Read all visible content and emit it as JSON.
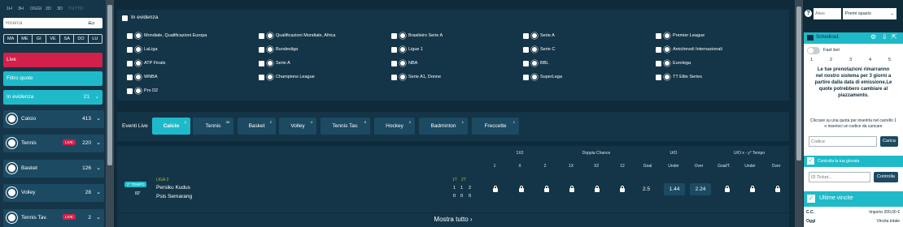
{
  "time_filters": [
    "1H",
    "3H",
    "OGGI",
    "2D",
    "3D",
    "TUTTO"
  ],
  "search": {
    "placeholder": "Ricerca"
  },
  "days": [
    "MA",
    "ME",
    "GI",
    "VE",
    "SA",
    "DO",
    "LU"
  ],
  "left_menu": {
    "live": "Live",
    "filtro": "Filtro quote",
    "evidenza": "In evidenza",
    "evidenza_count": "21"
  },
  "sports": [
    {
      "name": "Calcio",
      "count": "413",
      "live": false
    },
    {
      "name": "Tennis",
      "count": "220",
      "live": true
    },
    {
      "name": "Basket",
      "count": "126",
      "live": false
    },
    {
      "name": "Volley",
      "count": "28",
      "live": false
    },
    {
      "name": "Tennis Tav.",
      "count": "2",
      "live": true
    }
  ],
  "live_badge": "LIVE",
  "featured": {
    "title": "In evidenza",
    "items": [
      "Mondiale, Qualificazioni Europa",
      "Qualificazioni Mondiale, Africa",
      "Brasileiro Serie A",
      "Serie A",
      "Premier League",
      "LaLiga",
      "Bundesliga",
      "Ligue 1",
      "Serie C",
      "Amichevoli Internazionali",
      "ATP Finals",
      "Serie A",
      "NBA",
      "BBL",
      "Eurolega",
      "WNBA",
      "Champions League",
      "Serie A1, Donne",
      "SuperLega",
      "TT Elite Series",
      "Pro D2"
    ]
  },
  "eventi_live": {
    "label": "Eventi Live",
    "tabs": [
      {
        "label": "Calcio",
        "count": "1",
        "active": true
      },
      {
        "label": "Tennis",
        "count": "38"
      },
      {
        "label": "Basket",
        "count": "2"
      },
      {
        "label": "Volley",
        "count": "4"
      },
      {
        "label": "Tennis Tav.",
        "count": "9"
      },
      {
        "label": "Hockey",
        "count": "2"
      },
      {
        "label": "Badminton",
        "count": "1"
      },
      {
        "label": "Freccette",
        "count": "1"
      }
    ]
  },
  "table": {
    "groups": [
      "1X2",
      "Doppia Chance",
      "U/O",
      "U/O x - y° Tempo"
    ],
    "cols": [
      "1",
      "X",
      "2",
      "1X",
      "X2",
      "12",
      "Goal",
      "Under",
      "Over",
      "Goal/T.",
      "Under",
      "Over"
    ],
    "match": {
      "period": "2° TEMPO",
      "minute": "82'",
      "league": "LIGA 2",
      "home": "Persiku Kudus",
      "away": "Psis Semarang",
      "h1t": "1T",
      "h2t": "2T",
      "s1": [
        "1",
        "1",
        "2"
      ],
      "s2": [
        "0",
        "0",
        "0"
      ],
      "goal": "2.5",
      "under": "1.44",
      "over": "2.24"
    }
  },
  "mostra": "Mostra tutto",
  "right": {
    "alias_placeholder": "Alias",
    "premi": "Premi spazio",
    "schedina": "Schedina1",
    "fast_bet": "Fast bet",
    "steps": [
      "1",
      "2",
      "3",
      "4",
      "5"
    ],
    "notice": "Le tue prenotazioni rimarranno nel nostro sistema per 3 giorni a partire dalla data di emissione.Le quote potrebbero cambiare al piazzamento.",
    "hint": "Cliccare su una quota per inserirla nel carrello 1 o inserisci un codice da caricare",
    "codice_placeholder": "Codice",
    "carica": "Carica",
    "controlla_title": "Controlla la tua giocata",
    "ticket_placeholder": "ID Ticket...",
    "controlla_btn": "Controlla",
    "ultime": "Ultime vincite",
    "cc": "C.C.",
    "importo": "Importo 200,00 €",
    "oggi": "Oggi",
    "vincita": "Vincita totale"
  }
}
